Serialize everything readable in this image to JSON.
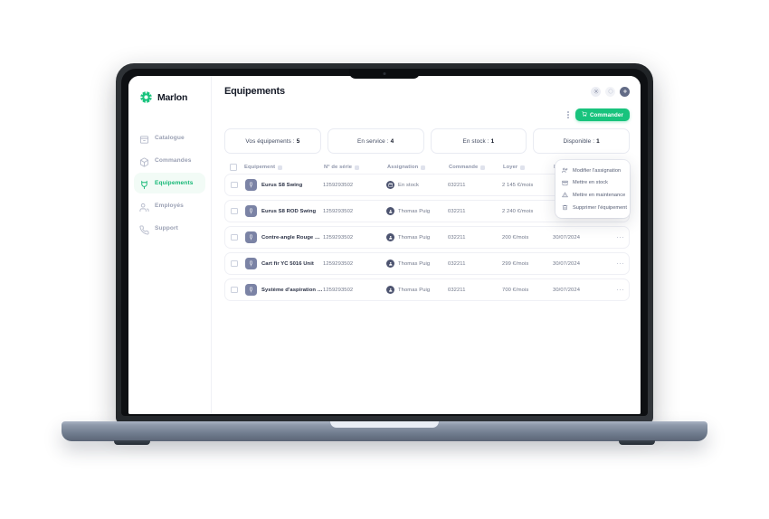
{
  "brand": {
    "name": "Marlon"
  },
  "sidebar": {
    "items": [
      {
        "label": "Catalogue",
        "icon": "catalog-icon",
        "active": false
      },
      {
        "label": "Commandes",
        "icon": "orders-icon",
        "active": false
      },
      {
        "label": "Equipements",
        "icon": "equipment-icon",
        "active": true
      },
      {
        "label": "Employés",
        "icon": "employees-icon",
        "active": false
      },
      {
        "label": "Support",
        "icon": "support-icon",
        "active": false
      }
    ]
  },
  "header": {
    "title": "Equipements",
    "icons": [
      "settings-icon",
      "help-icon",
      "add-icon"
    ]
  },
  "toolbar": {
    "more_label": "⋮",
    "order_label": "Commander",
    "order_icon": "cart-icon",
    "accent_color": "#18c37d"
  },
  "stats": [
    {
      "label": "Vos équipements :",
      "value": "5"
    },
    {
      "label": "En service :",
      "value": "4"
    },
    {
      "label": "En stock :",
      "value": "1"
    },
    {
      "label": "Disponible :",
      "value": "1"
    }
  ],
  "table": {
    "columns": [
      {
        "key": "equipement",
        "label": "Equipement"
      },
      {
        "key": "serie",
        "label": "N° de série"
      },
      {
        "key": "assignation",
        "label": "Assignation"
      },
      {
        "key": "commande",
        "label": "Commande"
      },
      {
        "key": "loyer",
        "label": "Loyer"
      },
      {
        "key": "date",
        "label": "Date"
      }
    ],
    "rows": [
      {
        "name": "Eurus S8 Swing",
        "serie": "1259293502",
        "assignation": "En stock",
        "assignation_type": "stock",
        "commande": "032211",
        "loyer": "2 145 €/mois",
        "date": ""
      },
      {
        "name": "Eurus S8 ROD Swing",
        "serie": "1259293502",
        "assignation": "Thomas Puig",
        "assignation_type": "person",
        "commande": "032211",
        "loyer": "2 240 €/mois",
        "date": ""
      },
      {
        "name": "Contre-angle Rouge Lumière New Ultimate",
        "serie": "1259293502",
        "assignation": "Thomas Puig",
        "assignation_type": "person",
        "commande": "032211",
        "loyer": "200 €/mois",
        "date": "30/07/2024"
      },
      {
        "name": "Cart fir YC 5016 Unit",
        "serie": "1259293502",
        "assignation": "Thomas Puig",
        "assignation_type": "person",
        "commande": "032211",
        "loyer": "299 €/mois",
        "date": "30/07/2024"
      },
      {
        "name": "Système d'aspiration extra oral Optimo",
        "serie": "1259293502",
        "assignation": "Thomas Puig",
        "assignation_type": "person",
        "commande": "032211",
        "loyer": "700 €/mois",
        "date": "30/07/2024"
      }
    ]
  },
  "row_menu": {
    "items": [
      {
        "label": "Modifier l'assignation",
        "icon": "user-edit-icon"
      },
      {
        "label": "Mettre en stock",
        "icon": "box-icon"
      },
      {
        "label": "Mettre en maintenance",
        "icon": "maintenance-icon"
      },
      {
        "label": "Supprimer l'équipement",
        "icon": "trash-icon"
      }
    ]
  }
}
